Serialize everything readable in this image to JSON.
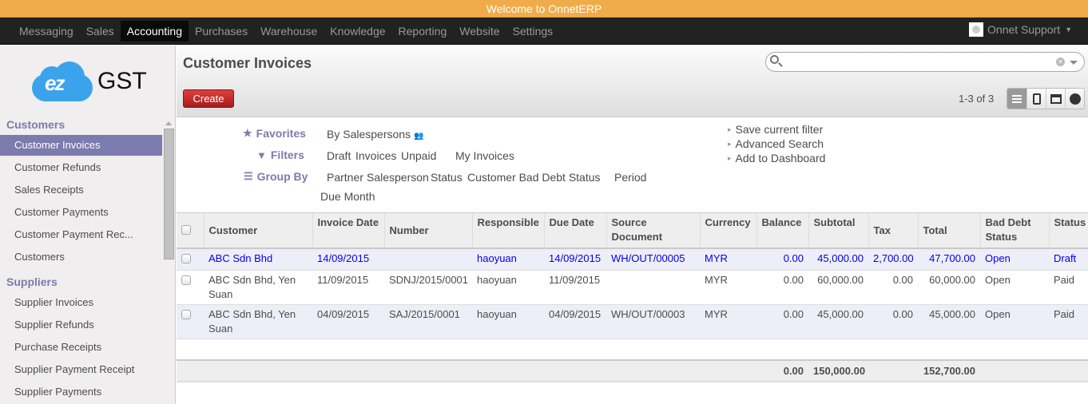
{
  "announcement": "Welcome to OnnetERP",
  "topnav": {
    "items": [
      "Messaging",
      "Sales",
      "Accounting",
      "Purchases",
      "Warehouse",
      "Knowledge",
      "Reporting",
      "Website",
      "Settings"
    ],
    "active": "Accounting",
    "user": "Onnet Support"
  },
  "logo": {
    "mark": "ez",
    "text": "GST"
  },
  "sidebar": {
    "sections": [
      {
        "title": "Customers",
        "items": [
          "Customer Invoices",
          "Customer Refunds",
          "Sales Receipts",
          "Customer Payments",
          "Customer Payment Rec...",
          "Customers"
        ]
      },
      {
        "title": "Suppliers",
        "items": [
          "Supplier Invoices",
          "Supplier Refunds",
          "Purchase Receipts",
          "Supplier Payment Receipt",
          "Supplier Payments"
        ]
      }
    ],
    "active_item": "Customer Invoices"
  },
  "header": {
    "title": "Customer Invoices",
    "create_label": "Create",
    "search_placeholder": "",
    "pager": "1-3 of 3",
    "views": [
      "list",
      "form",
      "calendar",
      "graph"
    ],
    "active_view": "list"
  },
  "filters": {
    "favorites_label": "Favorites",
    "favorites": [
      "By Salespersons"
    ],
    "filters_label": "Filters",
    "filters": [
      "Draft",
      "Invoices",
      "Unpaid",
      "My Invoices"
    ],
    "groupby_label": "Group By",
    "groupby": [
      "Partner",
      "Salesperson",
      "Status",
      "Customer Bad Debt Status",
      "Period",
      "Due Month"
    ],
    "actions": [
      "Save current filter",
      "Advanced Search",
      "Add to Dashboard"
    ]
  },
  "table": {
    "columns": [
      "Customer",
      "Invoice Date",
      "Number",
      "Responsible",
      "Due Date",
      "Source Document",
      "Currency",
      "Balance",
      "Subtotal",
      "Tax",
      "Total",
      "Bad Debt Status",
      "Status"
    ],
    "rows": [
      {
        "customer": "ABC Sdn Bhd",
        "invoice_date": "14/09/2015",
        "number": "",
        "responsible": "haoyuan",
        "due_date": "14/09/2015",
        "source": "WH/OUT/00005",
        "currency": "MYR",
        "balance": "0.00",
        "subtotal": "45,000.00",
        "tax": "2,700.00",
        "total": "47,700.00",
        "bad_debt": "Open",
        "status": "Draft"
      },
      {
        "customer": "ABC Sdn Bhd, Yen Suan",
        "invoice_date": "11/09/2015",
        "number": "SDNJ/2015/0001",
        "responsible": "haoyuan",
        "due_date": "11/09/2015",
        "source": "",
        "currency": "MYR",
        "balance": "0.00",
        "subtotal": "60,000.00",
        "tax": "0.00",
        "total": "60,000.00",
        "bad_debt": "Open",
        "status": "Paid"
      },
      {
        "customer": "ABC Sdn Bhd, Yen Suan",
        "invoice_date": "04/09/2015",
        "number": "SAJ/2015/0001",
        "responsible": "haoyuan",
        "due_date": "04/09/2015",
        "source": "WH/OUT/00003",
        "currency": "MYR",
        "balance": "0.00",
        "subtotal": "45,000.00",
        "tax": "0.00",
        "total": "45,000.00",
        "bad_debt": "Open",
        "status": "Paid"
      }
    ],
    "totals": {
      "balance": "0.00",
      "subtotal": "150,000.00",
      "total": "152,700.00"
    }
  },
  "colors": {
    "accent": "#7c7bad",
    "create": "#c02a2a",
    "announce": "#f0ac4b",
    "link": "#0000ee"
  }
}
